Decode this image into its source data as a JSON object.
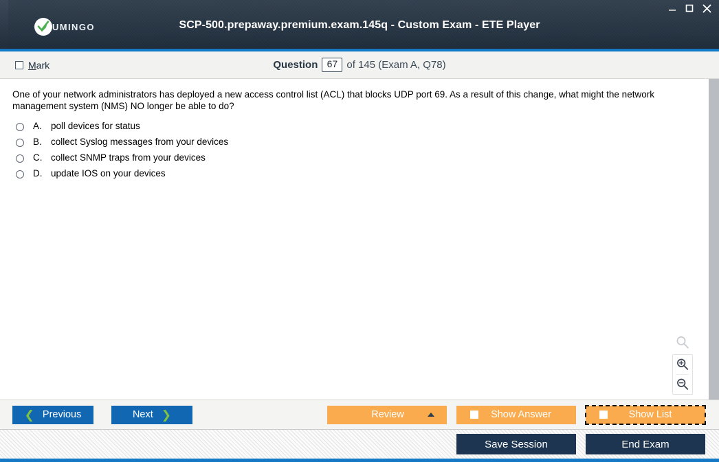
{
  "window": {
    "title": "SCP-500.prepaway.premium.exam.145q - Custom Exam - ETE Player",
    "logo_text": "UMINGO",
    "controls": {
      "minimize": "minimize-icon",
      "maximize": "maximize-icon",
      "close": "close-icon"
    },
    "accent_color": "#1479c4",
    "titlebar_color": "#2c3947"
  },
  "header": {
    "mark_label_prefix": "M",
    "mark_label_rest": "ark",
    "mark_checked": false,
    "question_word": "Question",
    "question_number": "67",
    "rest": "of 145 (Exam A, Q78)"
  },
  "question": {
    "text": "One of your network administrators has deployed a new access control list (ACL) that blocks UDP port 69. As a result of this change, what might the network management system (NMS) NO longer be able to do?",
    "options": [
      {
        "letter": "A.",
        "text": "poll devices for status",
        "selected": false
      },
      {
        "letter": "B.",
        "text": "collect Syslog messages from your devices",
        "selected": false
      },
      {
        "letter": "C.",
        "text": "collect SNMP traps from your devices",
        "selected": false
      },
      {
        "letter": "D.",
        "text": "update IOS on your devices",
        "selected": false
      }
    ]
  },
  "zoom_tools": {
    "search_icon": "magnifier-icon",
    "zoom_in_icon": "zoom-in-icon",
    "zoom_out_icon": "zoom-out-icon"
  },
  "toolbar": {
    "previous_label": "Previous",
    "next_label": "Next",
    "review_label": "Review",
    "show_answer_label": "Show Answer",
    "show_list_label": "Show List",
    "show_answer_checked": false,
    "show_list_checked": false,
    "show_list_focused": true,
    "button_color": "#1267b2",
    "chevron_color": "#7fc241",
    "orange_color": "#f9ab4e"
  },
  "footer": {
    "save_session_label": "Save Session",
    "end_exam_label": "End Exam",
    "button_color": "#1d3551"
  }
}
